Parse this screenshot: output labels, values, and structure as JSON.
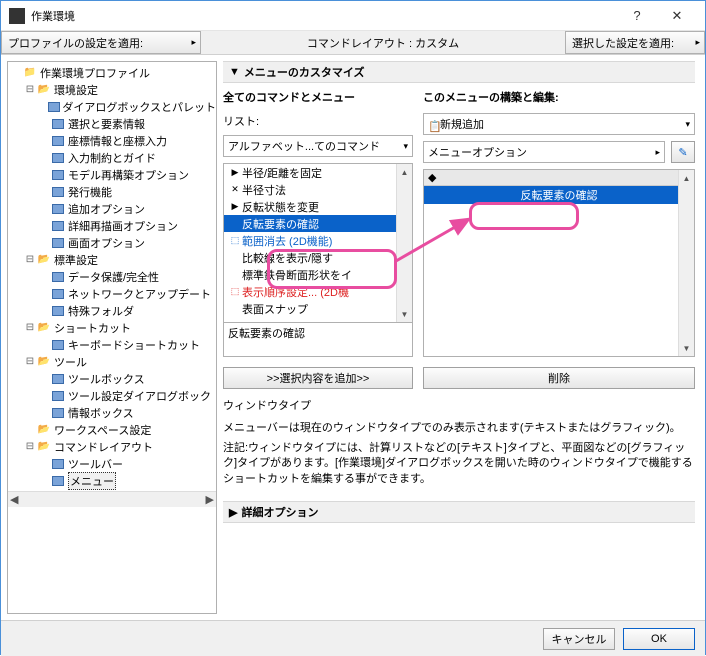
{
  "window": {
    "title": "作業環境"
  },
  "toolbar": {
    "profile_apply": "プロファイルの設定を適用:",
    "center": "コマンドレイアウト : カスタム",
    "selected_apply": "選択した設定を適用:"
  },
  "tree": {
    "root": "作業環境プロファイル",
    "groups": [
      {
        "label": "環境設定",
        "children": [
          "ダイアログボックスとパレット",
          "選択と要素情報",
          "座標情報と座標入力",
          "入力制約とガイド",
          "モデル再構築オプション",
          "発行機能",
          "追加オプション",
          "詳細再描画オプション",
          "画面オプション"
        ]
      },
      {
        "label": "標準設定",
        "children": [
          "データ保護/完全性",
          "ネットワークとアップデート",
          "特殊フォルダ"
        ]
      },
      {
        "label": "ショートカット",
        "children": [
          "キーボードショートカット"
        ]
      },
      {
        "label": "ツール",
        "children": [
          "ツールボックス",
          "ツール設定ダイアログボック",
          "情報ボックス"
        ]
      },
      {
        "label": "ワークスペース設定",
        "children": []
      },
      {
        "label": "コマンドレイアウト",
        "children": [
          "ツールバー",
          "メニュー"
        ]
      }
    ],
    "selected": "メニュー"
  },
  "main": {
    "section_title": "メニューのカスタマイズ",
    "left_header": "全てのコマンドとメニュー",
    "right_header": "このメニューの構築と編集:",
    "list_label": "リスト:",
    "right_combo": "新規追加",
    "left_filter": "アルファベット...てのコマンド",
    "right_filter": "メニューオプション",
    "left_items": [
      "半径/距離を固定",
      "半径寸法",
      "反転状態を変更",
      "反転要素の確認",
      "範囲消去 (2D機能)",
      "比較線を表示/隠す",
      "標準鉄骨断面形状をイ",
      "表示順序設定... (2D機",
      "表面スナップ"
    ],
    "left_selected": "反転要素の確認",
    "status": "反転要素の確認",
    "right_selected": "反転要素の確認",
    "btn_add": ">>選択内容を追加>>",
    "btn_del": "削除",
    "wtype_title": "ウィンドウタイプ",
    "wtype_text": "メニューバーは現在のウィンドウタイプでのみ表示されます(テキストまたはグラフィック)。",
    "wtype_note": "注記:ウィンドウタイプには、計算リストなどの[テキスト]タイプと、平面図などの[グラフィック]タイプがあります。[作業環境]ダイアログボックスを開いた時のウィンドウタイプで機能するショートカットを編集する事ができます。",
    "detail_title": "詳細オプション"
  },
  "footer": {
    "cancel": "キャンセル",
    "ok": "OK"
  }
}
